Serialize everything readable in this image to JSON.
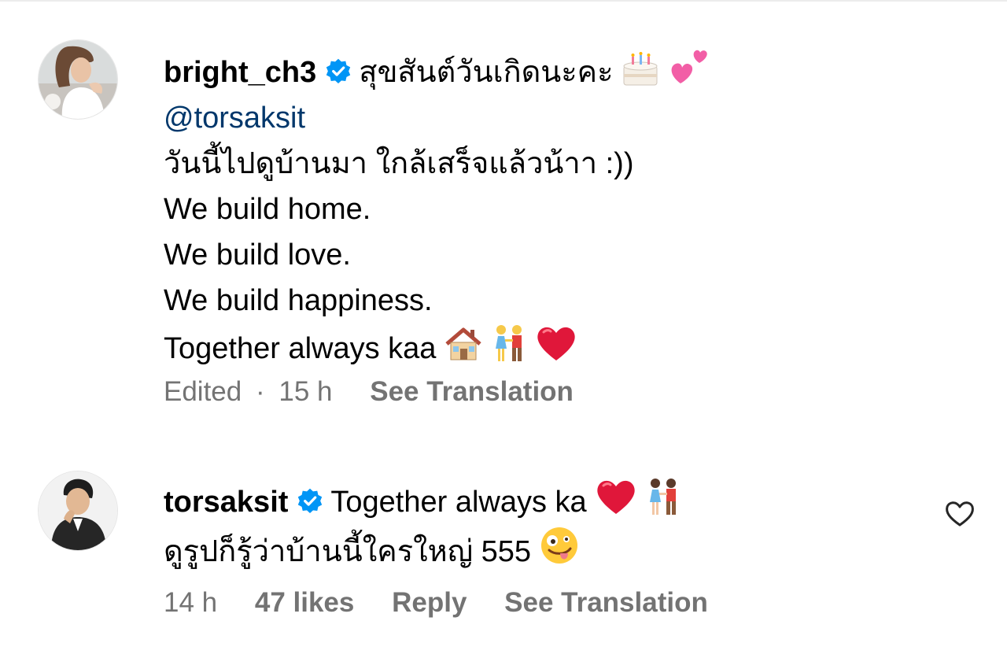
{
  "comments": [
    {
      "username": "bright_ch3",
      "verified": true,
      "lines": [
        "สุขสันต์วันเกิดนะคะ",
        "@torsaksit",
        "วันนี้ไปดูบ้านมา ใกล้เสร็จแล้วน้าา :))",
        "We build home.",
        "We build love.",
        "We build happiness.",
        "Together always kaa"
      ],
      "emojis": [
        "birthday-cake-emoji",
        "two-hearts-emoji",
        "house-emoji",
        "couple-emoji",
        "red-heart-emoji"
      ],
      "edited": "Edited",
      "separator": "·",
      "time": "15 h",
      "see_translation": "See Translation"
    },
    {
      "username": "torsaksit",
      "verified": true,
      "lines": [
        "Together always ka",
        "ดูรูปก็รู้ว่าบ้านนี้ใครใหญ่ 555"
      ],
      "emojis": [
        "red-heart-emoji",
        "couple-emoji",
        "zany-face-emoji"
      ],
      "time": "14 h",
      "likes": "47 likes",
      "reply": "Reply",
      "see_translation": "See Translation"
    }
  ],
  "colors": {
    "verified_blue": "#0095f6",
    "mention": "#00376b",
    "meta_gray": "#737373",
    "heart_red": "#e0173a"
  },
  "icons": {
    "verified": "verified-badge-icon",
    "like": "heart-outline-icon"
  }
}
